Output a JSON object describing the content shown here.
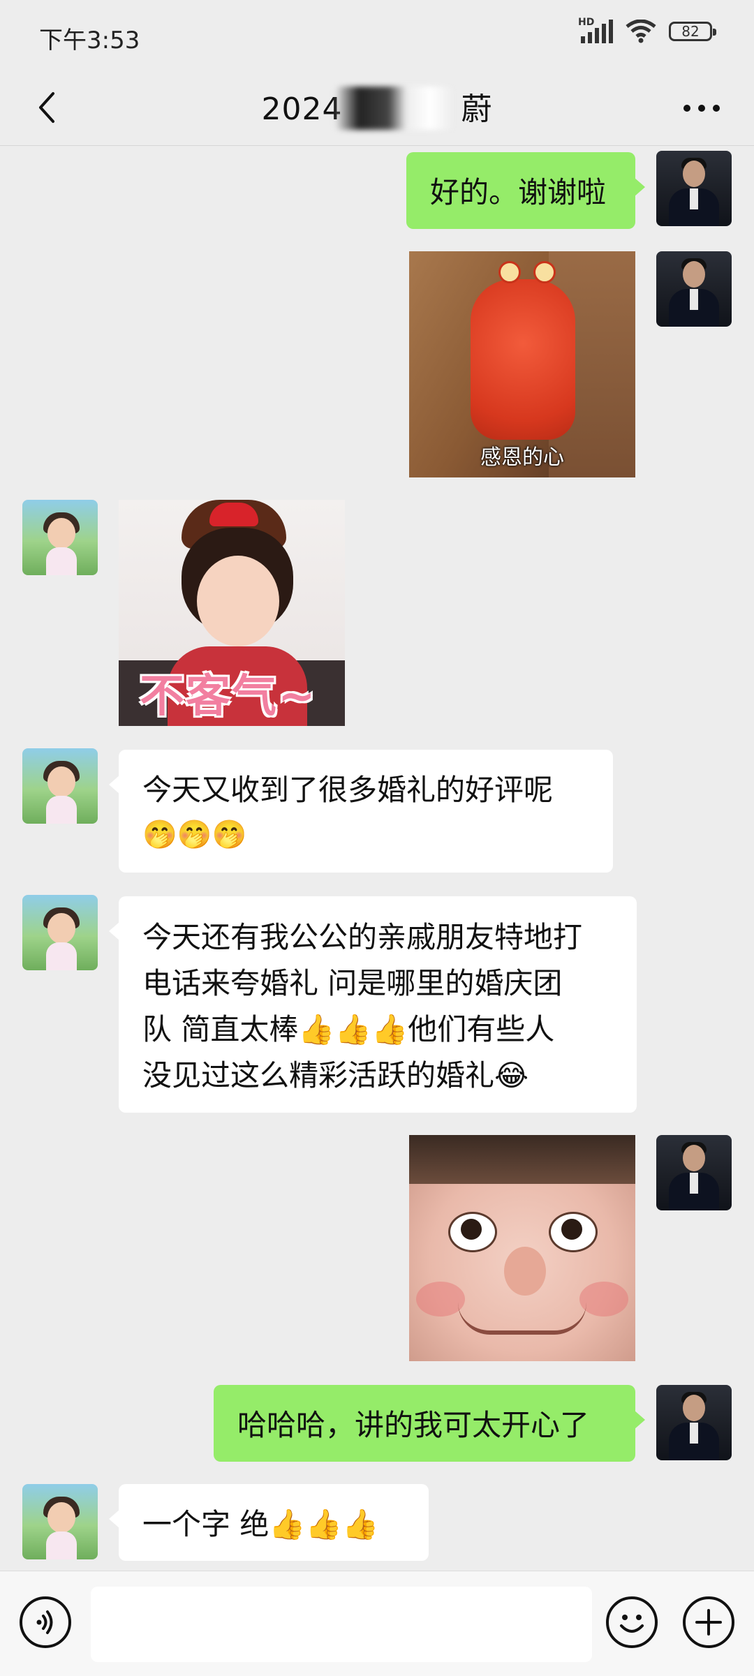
{
  "status_bar": {
    "time": "下午3:53",
    "network_badge": "HD",
    "battery": "82"
  },
  "header": {
    "title_visible": "2024",
    "title_tail": "蔚",
    "back_icon": "chevron-left-icon",
    "more_icon": "more-dots-icon"
  },
  "messages": [
    {
      "side": "me",
      "type": "text",
      "text": "好的。谢谢啦"
    },
    {
      "side": "me",
      "type": "sticker",
      "caption": "感恩的心"
    },
    {
      "side": "other",
      "type": "sticker",
      "caption": "不客气~"
    },
    {
      "side": "other",
      "type": "text",
      "text": "今天又收到了很多婚礼的好评呢",
      "emojis": "🤭🤭🤭"
    },
    {
      "side": "other",
      "type": "text",
      "lines": [
        "今天还有我公公的亲戚朋友特地打",
        "电话来夸婚礼 问是哪里的婚庆团",
        "队 简直太棒👍👍👍他们有些人",
        "没见过这么精彩活跃的婚礼😂"
      ]
    },
    {
      "side": "me",
      "type": "sticker",
      "caption": ""
    },
    {
      "side": "me",
      "type": "text",
      "text": "哈哈哈，讲的我可太开心了"
    },
    {
      "side": "other",
      "type": "text",
      "text": "一个字 绝👍👍👍"
    }
  ],
  "input_bar": {
    "voice_icon": "voice-icon",
    "emoji_icon": "emoji-icon",
    "plus_icon": "plus-icon",
    "placeholder": ""
  },
  "colors": {
    "background": "#ededed",
    "my_bubble": "#95ec69",
    "their_bubble": "#ffffff"
  }
}
